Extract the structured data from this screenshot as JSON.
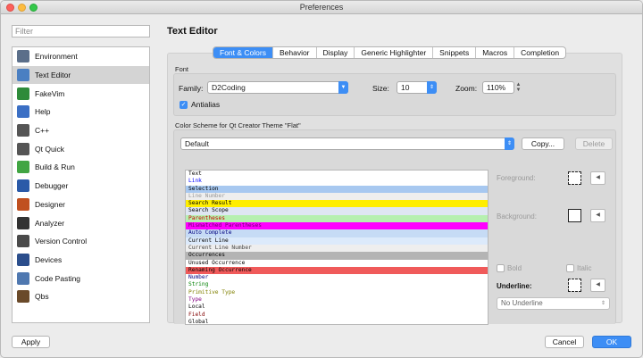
{
  "window": {
    "title": "Preferences"
  },
  "filter": {
    "placeholder": "Filter"
  },
  "sidebar": {
    "items": [
      {
        "label": "Environment",
        "icon": "environment-icon",
        "color": "#5b6f8a"
      },
      {
        "label": "Text Editor",
        "icon": "text-editor-icon",
        "color": "#4a7fc2",
        "selected": true
      },
      {
        "label": "FakeVim",
        "icon": "fakevim-icon",
        "color": "#2e8b3a"
      },
      {
        "label": "Help",
        "icon": "help-icon",
        "color": "#3b6fc4"
      },
      {
        "label": "C++",
        "icon": "cpp-icon",
        "color": "#555555"
      },
      {
        "label": "Qt Quick",
        "icon": "qt-quick-icon",
        "color": "#555555"
      },
      {
        "label": "Build & Run",
        "icon": "build-run-icon",
        "color": "#41a543"
      },
      {
        "label": "Debugger",
        "icon": "debugger-icon",
        "color": "#2a5aa8"
      },
      {
        "label": "Designer",
        "icon": "designer-icon",
        "color": "#c05020"
      },
      {
        "label": "Analyzer",
        "icon": "analyzer-icon",
        "color": "#333333"
      },
      {
        "label": "Version Control",
        "icon": "version-control-icon",
        "color": "#4a4a4a"
      },
      {
        "label": "Devices",
        "icon": "devices-icon",
        "color": "#2b4e8c"
      },
      {
        "label": "Code Pasting",
        "icon": "code-pasting-icon",
        "color": "#4f78b0"
      },
      {
        "label": "Qbs",
        "icon": "qbs-icon",
        "color": "#6a4a2a"
      }
    ]
  },
  "page": {
    "title": "Text Editor"
  },
  "tabs": [
    {
      "label": "Font & Colors",
      "active": true
    },
    {
      "label": "Behavior"
    },
    {
      "label": "Display"
    },
    {
      "label": "Generic Highlighter"
    },
    {
      "label": "Snippets"
    },
    {
      "label": "Macros"
    },
    {
      "label": "Completion"
    }
  ],
  "font_group": {
    "title": "Font",
    "family_label": "Family:",
    "family_value": "D2Coding",
    "size_label": "Size:",
    "size_value": "10",
    "zoom_label": "Zoom:",
    "zoom_value": "110%",
    "antialias_label": "Antialias",
    "antialias_checked": true
  },
  "scheme_group": {
    "title": "Color Scheme for Qt Creator Theme \"Flat\"",
    "scheme_value": "Default",
    "copy_label": "Copy...",
    "delete_label": "Delete"
  },
  "scheme_items": [
    {
      "label": "Text",
      "fg": "#000000",
      "bg": "#ffffff"
    },
    {
      "label": "Link",
      "fg": "#0000ff",
      "bg": "#ffffff"
    },
    {
      "label": "Selection",
      "fg": "#000000",
      "bg": "#a7c8f0"
    },
    {
      "label": "Line Number",
      "fg": "#9a9a9a",
      "bg": "#eeeeee"
    },
    {
      "label": "Search Result",
      "fg": "#000000",
      "bg": "#ffee00"
    },
    {
      "label": "Search Scope",
      "fg": "#000000",
      "bg": "#dfe6f3"
    },
    {
      "label": "Parentheses",
      "fg": "#cc0000",
      "bg": "#b6f0b0"
    },
    {
      "label": "Mismatched Parentheses",
      "fg": "#6a006a",
      "bg": "#ff00ff"
    },
    {
      "label": "Auto Complete",
      "fg": "#000080",
      "bg": "#c6dbf5"
    },
    {
      "label": "Current Line",
      "fg": "#000000",
      "bg": "#dceafb"
    },
    {
      "label": "Current Line Number",
      "fg": "#444444",
      "bg": "#eeeeee"
    },
    {
      "label": "Occurrences",
      "fg": "#000000",
      "bg": "#b4b4b4"
    },
    {
      "label": "Unused Occurrence",
      "fg": "#000000",
      "bg": "#ffffff"
    },
    {
      "label": "Renaming Occurrence",
      "fg": "#000000",
      "bg": "#f05a5a"
    },
    {
      "label": "Number",
      "fg": "#000080",
      "bg": "#ffffff"
    },
    {
      "label": "String",
      "fg": "#008000",
      "bg": "#ffffff"
    },
    {
      "label": "Primitive Type",
      "fg": "#808000",
      "bg": "#ffffff"
    },
    {
      "label": "Type",
      "fg": "#800080",
      "bg": "#ffffff"
    },
    {
      "label": "Local",
      "fg": "#000000",
      "bg": "#ffffff"
    },
    {
      "label": "Field",
      "fg": "#800000",
      "bg": "#ffffff"
    },
    {
      "label": "Global",
      "fg": "#000000",
      "bg": "#ffffff"
    }
  ],
  "properties": {
    "foreground_label": "Foreground:",
    "background_label": "Background:",
    "bold_label": "Bold",
    "italic_label": "Italic",
    "underline_label": "Underline:",
    "underline_value": "No Underline"
  },
  "footer": {
    "apply_label": "Apply",
    "cancel_label": "Cancel",
    "ok_label": "OK"
  }
}
